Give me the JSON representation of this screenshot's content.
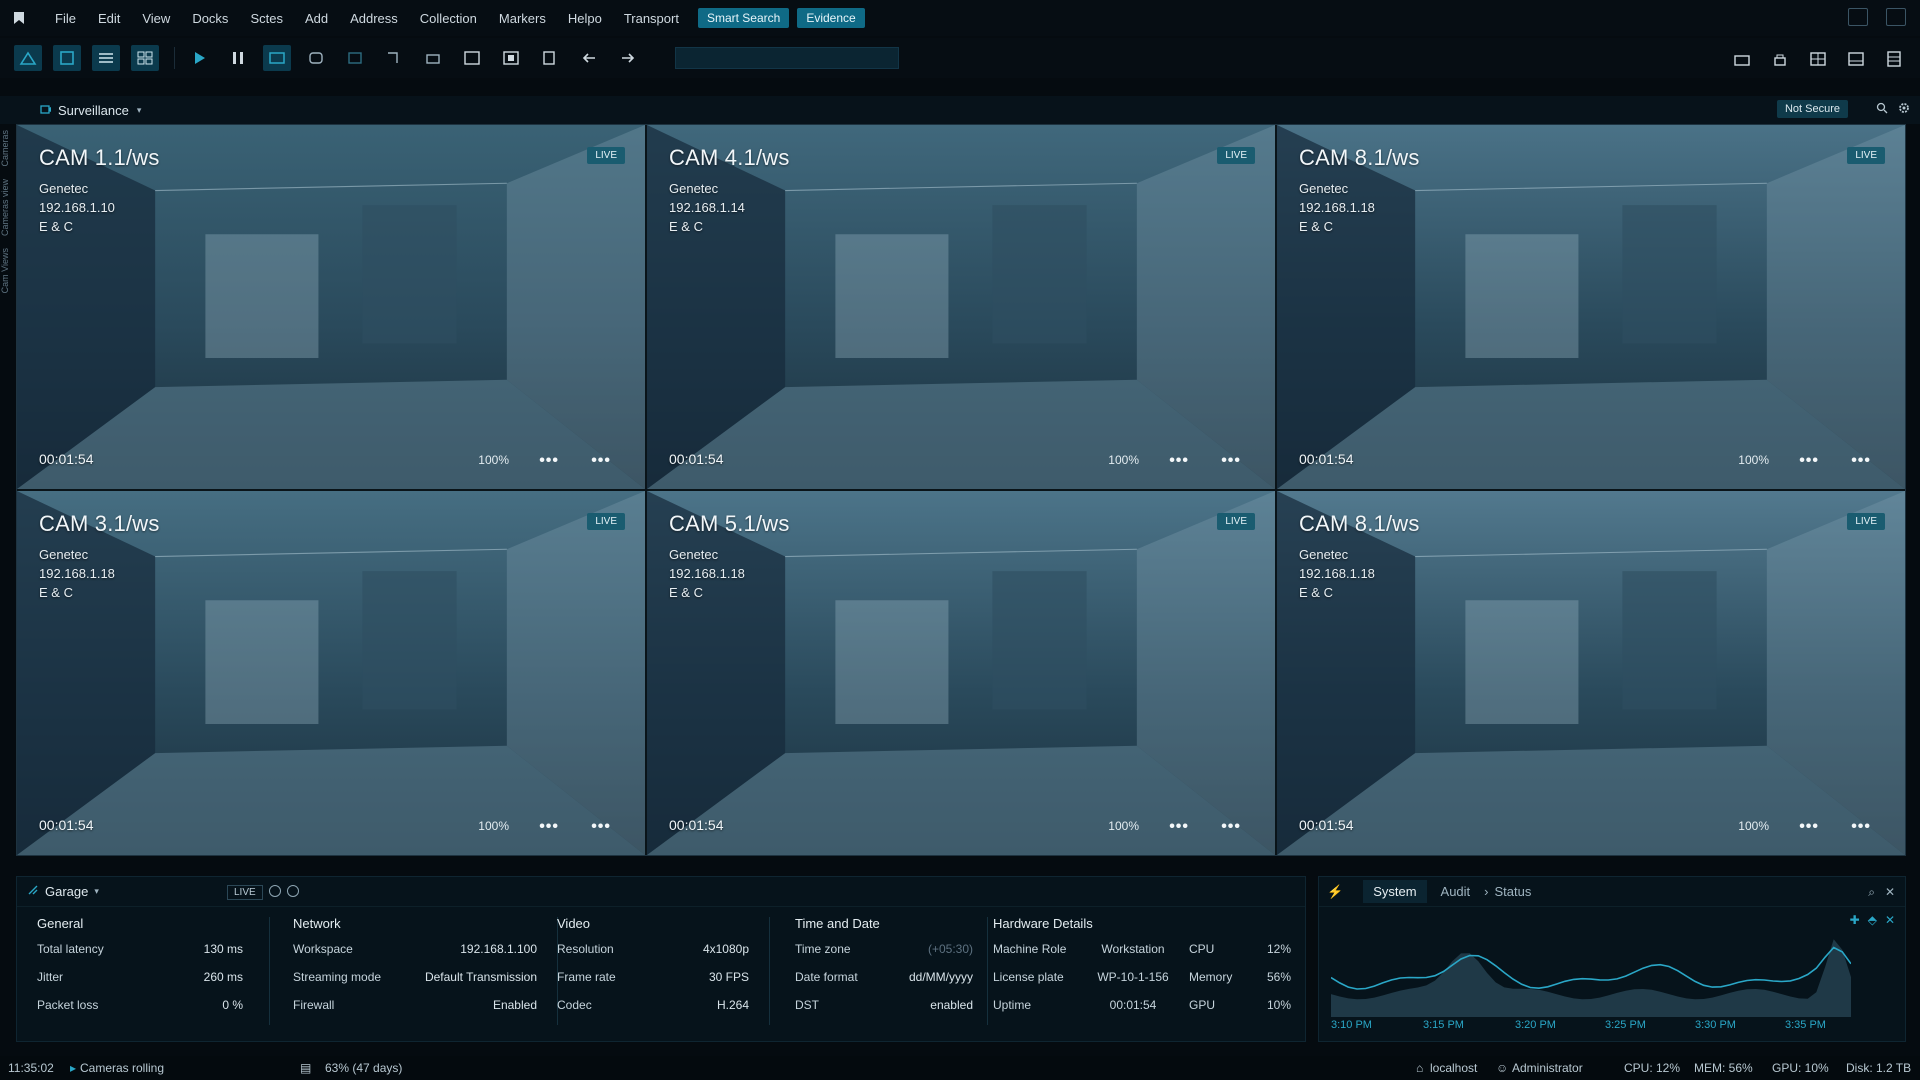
{
  "menubar": {
    "items": [
      "File",
      "Edit",
      "View",
      "Docks",
      "Sctes",
      "Add",
      "Address",
      "Collection",
      "Markers",
      "Helpo",
      "Transport"
    ],
    "pills": [
      "Smart Search",
      "Evidence"
    ]
  },
  "toolbar": {
    "search_value": ""
  },
  "panel": {
    "title": "Surveillance",
    "security": "Not Secure"
  },
  "left_strip": [
    "Cameras",
    "Cameras view",
    "Cam Views"
  ],
  "cameras": [
    {
      "title": "CAM 1.1/ws",
      "vendor": "Genetec",
      "ip": "192.168.1.10",
      "group": "E & C",
      "live": "LIVE",
      "time": "00:01:54",
      "zoom": "100%",
      "tone": "#3a6275"
    },
    {
      "title": "CAM 4.1/ws",
      "vendor": "Genetec",
      "ip": "192.168.1.14",
      "group": "E & C",
      "live": "LIVE",
      "time": "00:01:54",
      "zoom": "100%",
      "tone": "#40687c"
    },
    {
      "title": "CAM 8.1/ws",
      "vendor": "Genetec",
      "ip": "192.168.1.18",
      "group": "E & C",
      "live": "LIVE",
      "time": "00:01:54",
      "zoom": "100%",
      "tone": "#4a7287"
    },
    {
      "title": "CAM 3.1/ws",
      "vendor": "Genetec",
      "ip": "192.168.1.18",
      "group": "E & C",
      "live": "LIVE",
      "time": "00:01:54",
      "zoom": "100%",
      "tone": "#466e82"
    },
    {
      "title": "CAM 5.1/ws",
      "vendor": "Genetec",
      "ip": "192.168.1.18",
      "group": "E & C",
      "live": "LIVE",
      "time": "00:01:54",
      "zoom": "100%",
      "tone": "#4c7489"
    },
    {
      "title": "CAM 8.1/ws",
      "vendor": "Genetec",
      "ip": "192.168.1.18",
      "group": "E & C",
      "live": "LIVE",
      "time": "00:01:54",
      "zoom": "100%",
      "tone": "#52798e"
    }
  ],
  "garage": {
    "title": "Garage",
    "live": "LIVE",
    "general": {
      "header": "General",
      "rows": [
        {
          "label": "Total latency",
          "value": "130 ms"
        },
        {
          "label": "Jitter",
          "value": "260 ms"
        },
        {
          "label": "Packet loss",
          "value": "0 %"
        }
      ]
    },
    "network": {
      "header": "Network",
      "rows": [
        {
          "label": "Workspace",
          "value": "192.168.1.100"
        },
        {
          "label": "Streaming mode",
          "value": "Default Transmission"
        },
        {
          "label": "Firewall",
          "value": "Enabled"
        }
      ]
    },
    "video": {
      "header": "Video",
      "rows": [
        {
          "label": "Resolution",
          "value": "4x1080p"
        },
        {
          "label": "Frame rate",
          "value": "30 FPS"
        },
        {
          "label": "Codec",
          "value": "H.264"
        }
      ]
    },
    "time": {
      "header": "Time and Date",
      "rows": [
        {
          "label": "Time zone",
          "value": "(+05:30)"
        },
        {
          "label": "Date format",
          "value": "dd/MM/yyyy"
        },
        {
          "label": "DST",
          "value": "enabled"
        }
      ]
    },
    "hardware": {
      "header": "Hardware Details",
      "rows": [
        {
          "label": "Machine Role",
          "value": "Workstation",
          "metric": "CPU",
          "metric_value": "12%"
        },
        {
          "label": "License plate",
          "value": "WP-10-1-156",
          "metric": "Memory",
          "metric_value": "56%"
        },
        {
          "label": "Uptime",
          "value": "00:01:54",
          "metric": "GPU",
          "metric_value": "10%"
        }
      ]
    }
  },
  "system": {
    "tabs": [
      "System",
      "Audit",
      "Status"
    ],
    "ticks": [
      "3:10 PM",
      "3:15 PM",
      "3:20 PM",
      "3:25 PM",
      "3:30 PM",
      "3:35 PM"
    ],
    "colors": {
      "line": "#2aa7c7",
      "fill": "#24414f"
    }
  },
  "status": {
    "time": "11:35:02",
    "message": "Cameras rolling",
    "storage": "63% (47 days)",
    "host": "localhost",
    "user": "Administrator",
    "cpu": "CPU: 12%",
    "mem": "MEM: 56%",
    "gpu": "GPU: 10%",
    "disk": "Disk: 1.2 TB"
  }
}
